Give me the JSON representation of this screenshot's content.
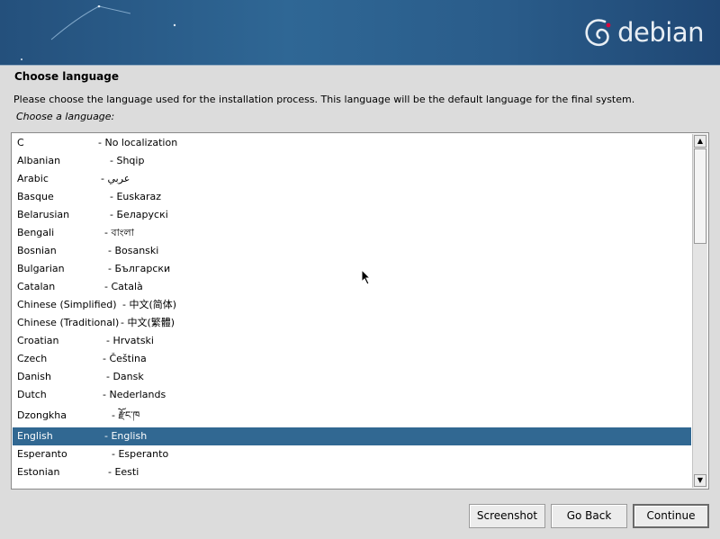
{
  "banner": {
    "logo_text": "debian"
  },
  "heading": "Choose language",
  "description": "Please choose the language used for the installation process. This language will be the default language for the final system.",
  "prompt": "Choose a language:",
  "languages": [
    {
      "name": "C",
      "native": "- No localization"
    },
    {
      "name": "Albanian",
      "native": "- Shqip"
    },
    {
      "name": "Arabic",
      "native": "- عربي"
    },
    {
      "name": "Basque",
      "native": "- Euskaraz"
    },
    {
      "name": "Belarusian",
      "native": "- Беларускі"
    },
    {
      "name": "Bengali",
      "native": "- বাংলা"
    },
    {
      "name": "Bosnian",
      "native": "- Bosanski"
    },
    {
      "name": "Bulgarian",
      "native": "- Български"
    },
    {
      "name": "Catalan",
      "native": "- Català"
    },
    {
      "name": "Chinese (Simplified)",
      "native": "- 中文(简体)"
    },
    {
      "name": "Chinese (Traditional)",
      "native": "- 中文(繁體)"
    },
    {
      "name": "Croatian",
      "native": "- Hrvatski"
    },
    {
      "name": "Czech",
      "native": "- Čeština"
    },
    {
      "name": "Danish",
      "native": "- Dansk"
    },
    {
      "name": "Dutch",
      "native": "- Nederlands"
    },
    {
      "name": "Dzongkha",
      "native": "- རྫོང་ཁ"
    },
    {
      "name": "English",
      "native": "- English",
      "selected": true
    },
    {
      "name": "Esperanto",
      "native": "- Esperanto"
    },
    {
      "name": "Estonian",
      "native": "- Eesti"
    }
  ],
  "buttons": {
    "screenshot": "Screenshot",
    "back": "Go Back",
    "continue": "Continue"
  },
  "colors": {
    "selection": "#316892",
    "banner": "#2f6795",
    "background": "#dcdcdc"
  }
}
